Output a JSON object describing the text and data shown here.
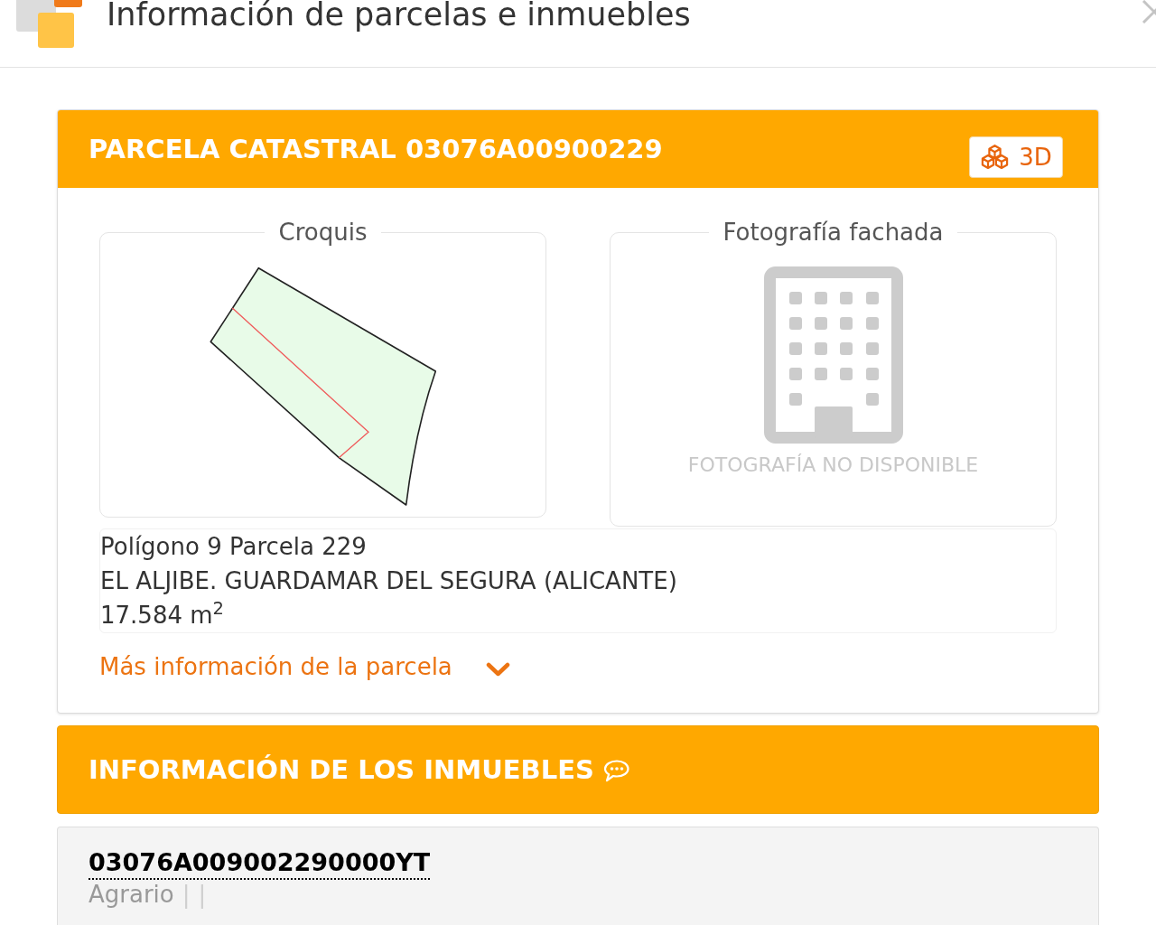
{
  "window": {
    "title": "Información de parcelas e inmuebles"
  },
  "parcel_card": {
    "title": "PARCELA CATASTRAL 03076A00900229",
    "view_3d_button": "3D",
    "sketch": {
      "legend": "Croquis"
    },
    "facade_photo": {
      "legend": "Fotografía fachada",
      "unavailable_text": "FOTOGRAFÍA NO DISPONIBLE"
    },
    "details": [
      "Polígono 9 Parcela 229",
      "EL ALJIBE. GUARDAMAR DEL SEGURA (ALICANTE)",
      "17.584 m$^{2}$"
    ],
    "more_info_link": {
      "label": "Más información de la parcela",
      "expanded": false
    }
  },
  "properties_card": {
    "title": "INFORMACIÓN DE LOS INMUEBLES"
  },
  "properties": [
    {
      "reference": "03076A009002290000YT",
      "summary": [
        {
          "kind": "value",
          "text": "Agrario"
        },
        {
          "kind": "separator",
          "text": "|"
        },
        {
          "kind": "separator",
          "text": "|"
        }
      ]
    }
  ]
}
